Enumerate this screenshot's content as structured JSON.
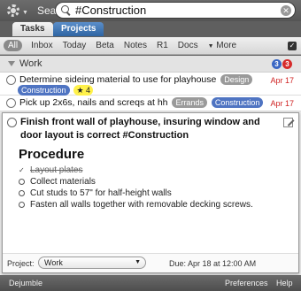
{
  "search": {
    "label": "Search",
    "value": "#Construction"
  },
  "tabs": [
    {
      "label": "Tasks"
    },
    {
      "label": "Projects"
    }
  ],
  "filters": [
    "All",
    "Inbox",
    "Today",
    "Beta",
    "Notes",
    "R1",
    "Docs",
    "More"
  ],
  "group": {
    "name": "Work",
    "count_blue": "3",
    "count_red": "3"
  },
  "tasks": [
    {
      "title": "Determine sideing material to use for playhouse",
      "tags": [
        "Design",
        "Construction"
      ],
      "star": "★ 4",
      "date": "Apr 17"
    },
    {
      "title": "Pick up 2x6s, nails and screqs at hh",
      "tags": [
        "Errands",
        "Construction"
      ],
      "date": "Apr 17"
    }
  ],
  "expanded": {
    "title": "Finish front wall of playhouse, insuring window and door layout is correct #Construction",
    "notes_heading": "Procedure",
    "steps": [
      {
        "text": "Layout plates",
        "done": true
      },
      {
        "text": "Collect materials",
        "done": false
      },
      {
        "text": "Cut studs to 57\" for half-height walls",
        "done": false
      },
      {
        "text": "Fasten all walls together with removable decking screws.",
        "done": false
      }
    ],
    "project_label": "Project:",
    "project_value": "Work",
    "due": "Due: Apr 18 at 12:00 AM"
  },
  "bottom": {
    "left": "Dejumble",
    "preferences": "Preferences",
    "help": "Help"
  },
  "icons": {
    "gear": "gear-icon",
    "search": "search-icon",
    "clear": "clear-icon",
    "edit": "edit-icon",
    "checkbox": "checkbox-icon"
  }
}
